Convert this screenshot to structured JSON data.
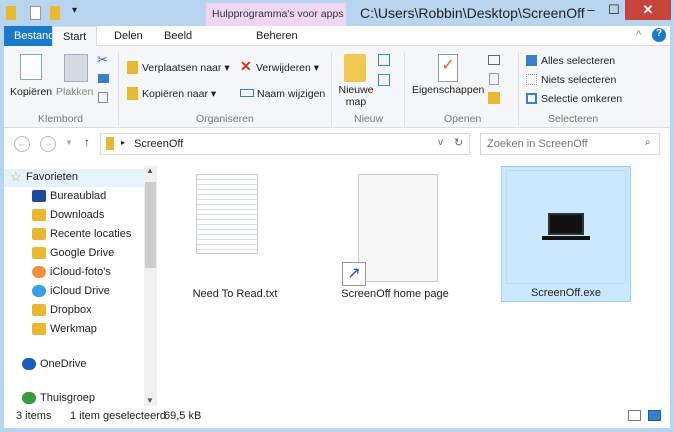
{
  "window": {
    "title": "C:\\Users\\Robbin\\Desktop\\ScreenOff",
    "context_tab": "Hulpprogramma's voor apps",
    "minimize": "–",
    "maximize": "☐",
    "close": "✕"
  },
  "tabs": [
    "Bestand",
    "Start",
    "Delen",
    "Beeld",
    "Beheren"
  ],
  "ribbon": {
    "klembord": {
      "label": "Klembord",
      "kopieren": "Kopiëren",
      "plakken": "Plakken"
    },
    "organiseren": {
      "label": "Organiseren",
      "verplaatsen": "Verplaatsen naar",
      "kopieren_naar": "Kopiëren naar",
      "verwijderen": "Verwijderen",
      "naam": "Naam wijzigen"
    },
    "nieuw": {
      "label": "Nieuw",
      "map": "Nieuwe map"
    },
    "openen": {
      "label": "Openen",
      "eigenschappen": "Eigenschappen"
    },
    "selecteren": {
      "label": "Selecteren",
      "alles": "Alles selecteren",
      "niets": "Niets selecteren",
      "omkeren": "Selectie omkeren"
    }
  },
  "address": {
    "path": "ScreenOff",
    "search_placeholder": "Zoeken in ScreenOff"
  },
  "nav": {
    "favorites": "Favorieten",
    "items": [
      "Bureaublad",
      "Downloads",
      "Recente locaties",
      "Google Drive",
      "iCloud-foto's",
      "iCloud Drive",
      "Dropbox",
      "Werkmap"
    ],
    "onedrive": "OneDrive",
    "homegroup": "Thuisgroep"
  },
  "files": [
    {
      "name": "Need To Read.txt",
      "selected": false
    },
    {
      "name": "ScreenOff home page",
      "selected": false
    },
    {
      "name": "ScreenOff.exe",
      "selected": true
    }
  ],
  "status": {
    "count": "3 items",
    "selection": "1 item geselecteerd",
    "size": "69,5 kB"
  },
  "colors": {
    "accent": "#1979ca",
    "selection": "#cce8ff",
    "context": "#efd6f5"
  }
}
